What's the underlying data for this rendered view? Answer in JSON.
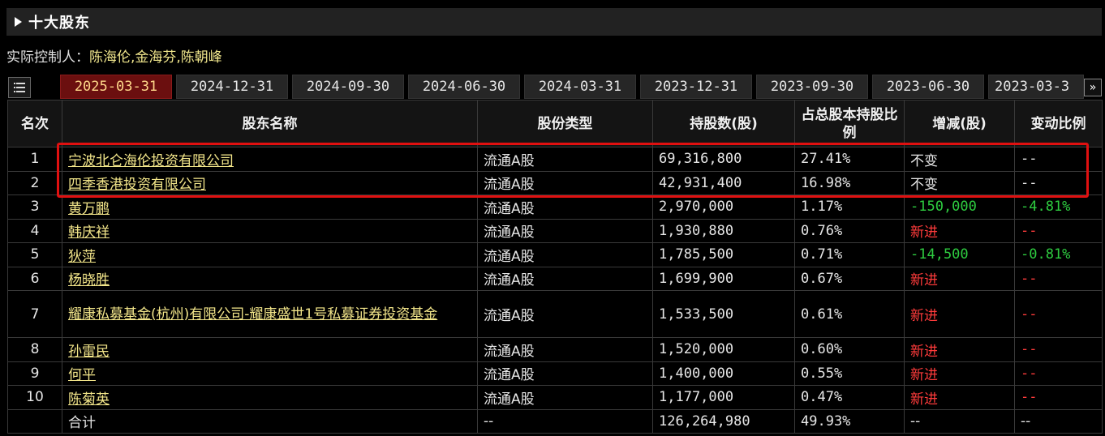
{
  "section": {
    "title": "十大股东"
  },
  "controller": {
    "label": "实际控制人：",
    "names": "陈海伦,金海芬,陈朝峰"
  },
  "tabs": [
    "2025-03-31",
    "2024-12-31",
    "2024-09-30",
    "2024-06-30",
    "2024-03-31",
    "2023-12-31",
    "2023-09-30",
    "2023-06-30",
    "2023-03-3"
  ],
  "active_tab": 0,
  "more_icon": "»",
  "table": {
    "headers": {
      "rank": "名次",
      "name": "股东名称",
      "type": "股份类型",
      "shares": "持股数(股)",
      "ratio": "占总股本持股比例",
      "change": "增减(股)",
      "change_ratio": "变动比例"
    },
    "rows": [
      {
        "rank": "1",
        "name": "宁波北仑海伦投资有限公司",
        "type": "流通A股",
        "shares": "69,316,800",
        "ratio": "27.41%",
        "change": "不变",
        "change_ratio": "--"
      },
      {
        "rank": "2",
        "name": "四季香港投资有限公司",
        "type": "流通A股",
        "shares": "42,931,400",
        "ratio": "16.98%",
        "change": "不变",
        "change_ratio": "--"
      },
      {
        "rank": "3",
        "name": "黄万鹏",
        "type": "流通A股",
        "shares": "2,970,000",
        "ratio": "1.17%",
        "change": "-150,000",
        "change_ratio": "-4.81%"
      },
      {
        "rank": "4",
        "name": "韩庆祥",
        "type": "流通A股",
        "shares": "1,930,880",
        "ratio": "0.76%",
        "change": "新进",
        "change_ratio": "--"
      },
      {
        "rank": "5",
        "name": "狄萍",
        "type": "流通A股",
        "shares": "1,785,500",
        "ratio": "0.71%",
        "change": "-14,500",
        "change_ratio": "-0.81%"
      },
      {
        "rank": "6",
        "name": "杨晓胜",
        "type": "流通A股",
        "shares": "1,699,900",
        "ratio": "0.67%",
        "change": "新进",
        "change_ratio": "--"
      },
      {
        "rank": "7",
        "name": "耀康私募基金(杭州)有限公司-耀康盛世1号私募证券投资基金",
        "type": "流通A股",
        "shares": "1,533,500",
        "ratio": "0.61%",
        "change": "新进",
        "change_ratio": "--"
      },
      {
        "rank": "8",
        "name": "孙雷民",
        "type": "流通A股",
        "shares": "1,520,000",
        "ratio": "0.60%",
        "change": "新进",
        "change_ratio": "--"
      },
      {
        "rank": "9",
        "name": "何平",
        "type": "流通A股",
        "shares": "1,400,000",
        "ratio": "0.55%",
        "change": "新进",
        "change_ratio": "--"
      },
      {
        "rank": "10",
        "name": "陈菊英",
        "type": "流通A股",
        "shares": "1,177,000",
        "ratio": "0.47%",
        "change": "新进",
        "change_ratio": "--"
      }
    ],
    "total": {
      "label": "合计",
      "type": "--",
      "shares": "126,264,980",
      "ratio": "49.93%",
      "change": "--",
      "change_ratio": "--"
    }
  },
  "colors": {
    "active_tab_bg": "#6b0f0f",
    "link": "#f3e68a",
    "increase_new": "#ff3b3b",
    "decrease": "#2ecc40",
    "highlight": "#e01010"
  }
}
